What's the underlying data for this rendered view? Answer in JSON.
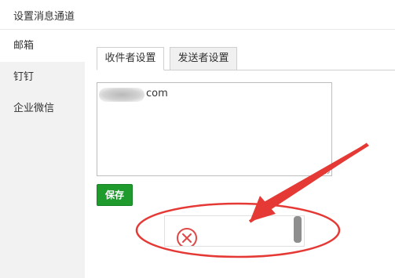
{
  "window": {
    "title": "设置消息通道"
  },
  "sidebar": {
    "items": [
      {
        "label": "邮箱",
        "active": true
      },
      {
        "label": "钉钉",
        "active": false
      },
      {
        "label": "企业微信",
        "active": false
      }
    ]
  },
  "tabs": [
    {
      "label": "收件者设置",
      "active": true
    },
    {
      "label": "发送者设置",
      "active": false
    }
  ],
  "recipients_field": {
    "value_visible_suffix": "com",
    "redacted": true
  },
  "save_button": {
    "label": "保存",
    "color": "#1f9b2e"
  },
  "popup": {
    "icon": "close-circle-icon",
    "icon_color": "#e04848"
  },
  "annotation": {
    "color": "#e53935",
    "shapes": [
      "ellipse-highlight",
      "arrow"
    ]
  }
}
